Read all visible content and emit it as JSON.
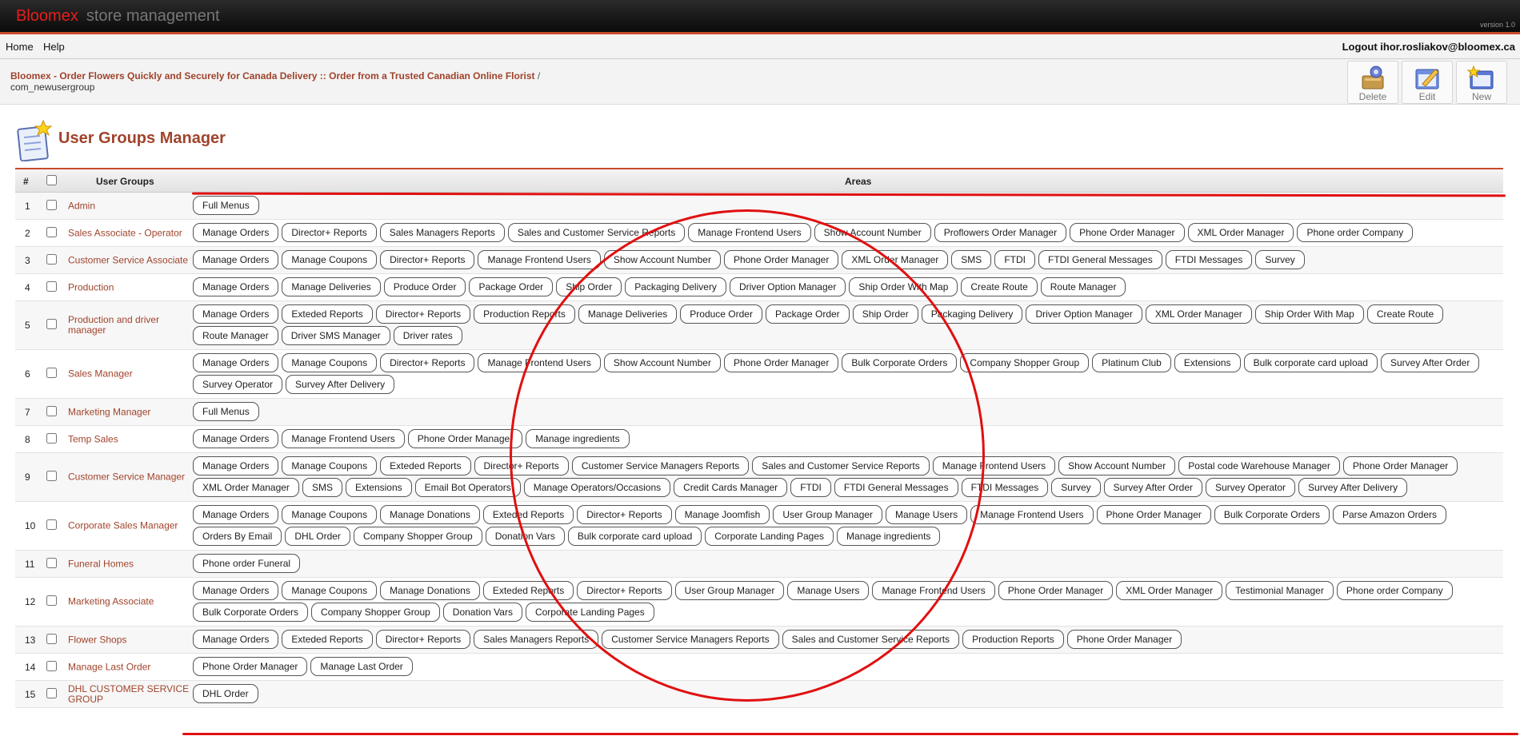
{
  "header": {
    "brand_primary": "Bloomex",
    "brand_secondary": "store management",
    "version": "version 1.0"
  },
  "menu": {
    "home": "Home",
    "help": "Help",
    "logout": "Logout ihor.rosliakov@bloomex.ca"
  },
  "breadcrumb": {
    "site": "Bloomex - Order Flowers Quickly and Securely for Canada Delivery :: Order from a Trusted Canadian Online Florist",
    "separator": "/",
    "component": "com_newusergroup"
  },
  "toolbar": {
    "delete_label": "Delete",
    "edit_label": "Edit",
    "new_label": "New"
  },
  "page": {
    "title": "User Groups Manager"
  },
  "table": {
    "col_num": "#",
    "col_groups": "User Groups",
    "col_areas": "Areas",
    "rows": [
      {
        "num": "1",
        "name": "Admin",
        "areas": [
          "Full Menus"
        ]
      },
      {
        "num": "2",
        "name": "Sales Associate - Operator",
        "areas": [
          "Manage Orders",
          "Director+ Reports",
          "Sales Managers Reports",
          "Sales and Customer Service Reports",
          "Manage Frontend Users",
          "Show Account Number",
          "Proflowers Order Manager",
          "Phone Order Manager",
          "XML Order Manager",
          "Phone order Company"
        ]
      },
      {
        "num": "3",
        "name": "Customer Service Associate",
        "areas": [
          "Manage Orders",
          "Manage Coupons",
          "Director+ Reports",
          "Manage Frontend Users",
          "Show Account Number",
          "Phone Order Manager",
          "XML Order Manager",
          "SMS",
          "FTDI",
          "FTDI General Messages",
          "FTDI Messages",
          "Survey"
        ]
      },
      {
        "num": "4",
        "name": "Production",
        "areas": [
          "Manage Orders",
          "Manage Deliveries",
          "Produce Order",
          "Package Order",
          "Ship Order",
          "Packaging Delivery",
          "Driver Option Manager",
          "Ship Order With Map",
          "Create Route",
          "Route Manager"
        ]
      },
      {
        "num": "5",
        "name": "Production and driver manager",
        "areas": [
          "Manage Orders",
          "Exteded Reports",
          "Director+ Reports",
          "Production Reports",
          "Manage Deliveries",
          "Produce Order",
          "Package Order",
          "Ship Order",
          "Packaging Delivery",
          "Driver Option Manager",
          "XML Order Manager",
          "Ship Order With Map",
          "Create Route",
          "Route Manager",
          "Driver SMS Manager",
          "Driver rates"
        ]
      },
      {
        "num": "6",
        "name": "Sales Manager",
        "areas": [
          "Manage Orders",
          "Manage Coupons",
          "Director+ Reports",
          "Manage Frontend Users",
          "Show Account Number",
          "Phone Order Manager",
          "Bulk Corporate Orders",
          "Company Shopper Group",
          "Platinum Club",
          "Extensions",
          "Bulk corporate card upload",
          "Survey After Order",
          "Survey Operator",
          "Survey After Delivery"
        ]
      },
      {
        "num": "7",
        "name": "Marketing Manager",
        "areas": [
          "Full Menus"
        ]
      },
      {
        "num": "8",
        "name": "Temp Sales",
        "areas": [
          "Manage Orders",
          "Manage Frontend Users",
          "Phone Order Manager",
          "Manage ingredients"
        ]
      },
      {
        "num": "9",
        "name": "Customer Service Manager",
        "areas": [
          "Manage Orders",
          "Manage Coupons",
          "Exteded Reports",
          "Director+ Reports",
          "Customer Service Managers Reports",
          "Sales and Customer Service Reports",
          "Manage Frontend Users",
          "Show Account Number",
          "Postal code Warehouse Manager",
          "Phone Order Manager",
          "XML Order Manager",
          "SMS",
          "Extensions",
          "Email Bot Operators",
          "Manage Operators/Occasions",
          "Credit Cards Manager",
          "FTDI",
          "FTDI General Messages",
          "FTDI Messages",
          "Survey",
          "Survey After Order",
          "Survey Operator",
          "Survey After Delivery"
        ]
      },
      {
        "num": "10",
        "name": "Corporate Sales Manager",
        "areas": [
          "Manage Orders",
          "Manage Coupons",
          "Manage Donations",
          "Exteded Reports",
          "Director+ Reports",
          "Manage Joomfish",
          "User Group Manager",
          "Manage Users",
          "Manage Frontend Users",
          "Phone Order Manager",
          "Bulk Corporate Orders",
          "Parse Amazon Orders",
          "Orders By Email",
          "DHL Order",
          "Company Shopper Group",
          "Donation Vars",
          "Bulk corporate card upload",
          "Corporate Landing Pages",
          "Manage ingredients"
        ]
      },
      {
        "num": "11",
        "name": "Funeral Homes",
        "areas": [
          "Phone order Funeral"
        ]
      },
      {
        "num": "12",
        "name": "Marketing Associate",
        "areas": [
          "Manage Orders",
          "Manage Coupons",
          "Manage Donations",
          "Exteded Reports",
          "Director+ Reports",
          "User Group Manager",
          "Manage Users",
          "Manage Frontend Users",
          "Phone Order Manager",
          "XML Order Manager",
          "Testimonial Manager",
          "Phone order Company",
          "Bulk Corporate Orders",
          "Company Shopper Group",
          "Donation Vars",
          "Corporate Landing Pages"
        ]
      },
      {
        "num": "13",
        "name": "Flower Shops",
        "areas": [
          "Manage Orders",
          "Exteded Reports",
          "Director+ Reports",
          "Sales Managers Reports",
          "Customer Service Managers Reports",
          "Sales and Customer Service Reports",
          "Production Reports",
          "Phone Order Manager"
        ]
      },
      {
        "num": "14",
        "name": "Manage Last Order",
        "areas": [
          "Phone Order Manager",
          "Manage Last Order"
        ]
      },
      {
        "num": "15",
        "name": "DHL CUSTOMER SERVICE GROUP",
        "areas": [
          "DHL Order"
        ]
      }
    ]
  },
  "colors": {
    "accent": "#a0432b",
    "header_rule": "#c84a2a",
    "annotation": "#e01010"
  },
  "icons": {
    "delete": "delete-icon",
    "edit": "edit-icon",
    "new": "new-icon",
    "title": "clipboard-star-icon"
  }
}
